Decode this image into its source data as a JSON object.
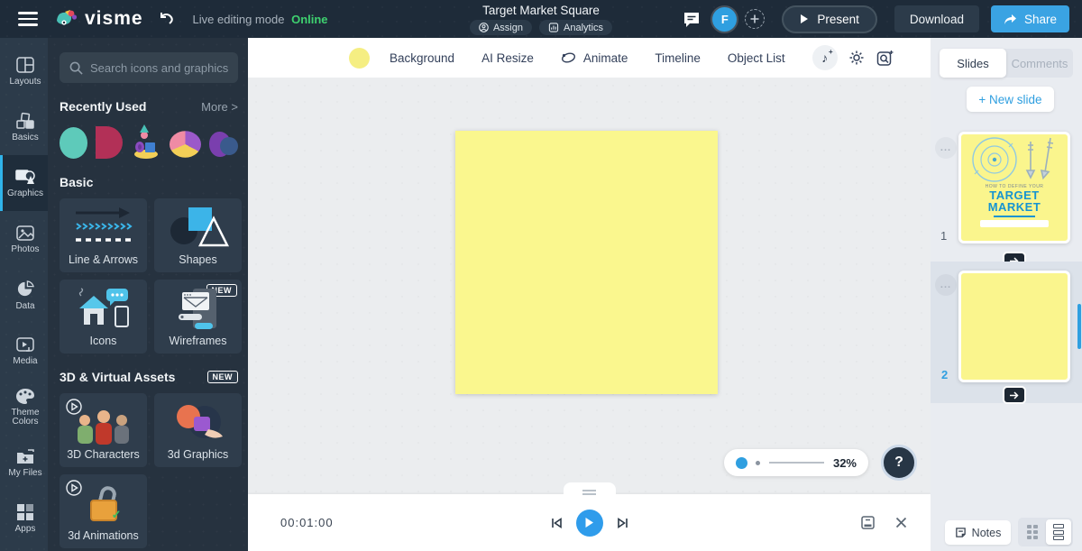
{
  "topbar": {
    "logo": "visme",
    "live_mode": "Live editing mode",
    "online": "Online",
    "title": "Target Market Square",
    "assign": "Assign",
    "analytics": "Analytics",
    "avatar": "F",
    "present": "Present",
    "download": "Download",
    "share": "Share"
  },
  "rail": {
    "items": [
      {
        "label": "Layouts"
      },
      {
        "label": "Basics"
      },
      {
        "label": "Graphics"
      },
      {
        "label": "Photos"
      },
      {
        "label": "Data"
      },
      {
        "label": "Media"
      },
      {
        "label": "Theme Colors"
      },
      {
        "label": "My Files"
      },
      {
        "label": "Apps"
      }
    ]
  },
  "panel": {
    "search_placeholder": "Search icons and graphics",
    "recent_title": "Recently Used",
    "more": "More >",
    "basic_title": "Basic",
    "tiles": {
      "line_arrows": "Line & Arrows",
      "shapes": "Shapes",
      "icons": "Icons",
      "wireframes": "Wireframes",
      "wireframes_badge": "NEW"
    },
    "assets_title": "3D & Virtual Assets",
    "assets_badge": "NEW",
    "assets_tiles": {
      "characters": "3D Characters",
      "graphics3d": "3d Graphics",
      "animations3d": "3d Animations"
    }
  },
  "ctoolbar": {
    "background": "Background",
    "ai_resize": "AI Resize",
    "animate": "Animate",
    "timeline": "Timeline",
    "object_list": "Object List"
  },
  "canvas": {
    "zoom": "32%",
    "help": "?"
  },
  "playbar": {
    "time": "00:01:00"
  },
  "rpanel": {
    "tab_slides": "Slides",
    "tab_comments": "Comments",
    "new_slide": "+ New slide",
    "slide1": {
      "number": "1",
      "kicker": "HOW TO DEFINE YOUR",
      "title1": "TARGET",
      "title2": "MARKET",
      "menu_dots": "..."
    },
    "slide2": {
      "number": "2",
      "menu_dots": "..."
    },
    "notes": "Notes"
  },
  "colors": {
    "accent_blue": "#2f9fe0",
    "share_blue": "#3aa3e3",
    "online_green": "#3ed06f",
    "slide_yellow": "#faf78e",
    "topbar_dark": "#1e2b39",
    "rail_dark": "#2c3b4a",
    "panel_dark": "#26323f"
  }
}
